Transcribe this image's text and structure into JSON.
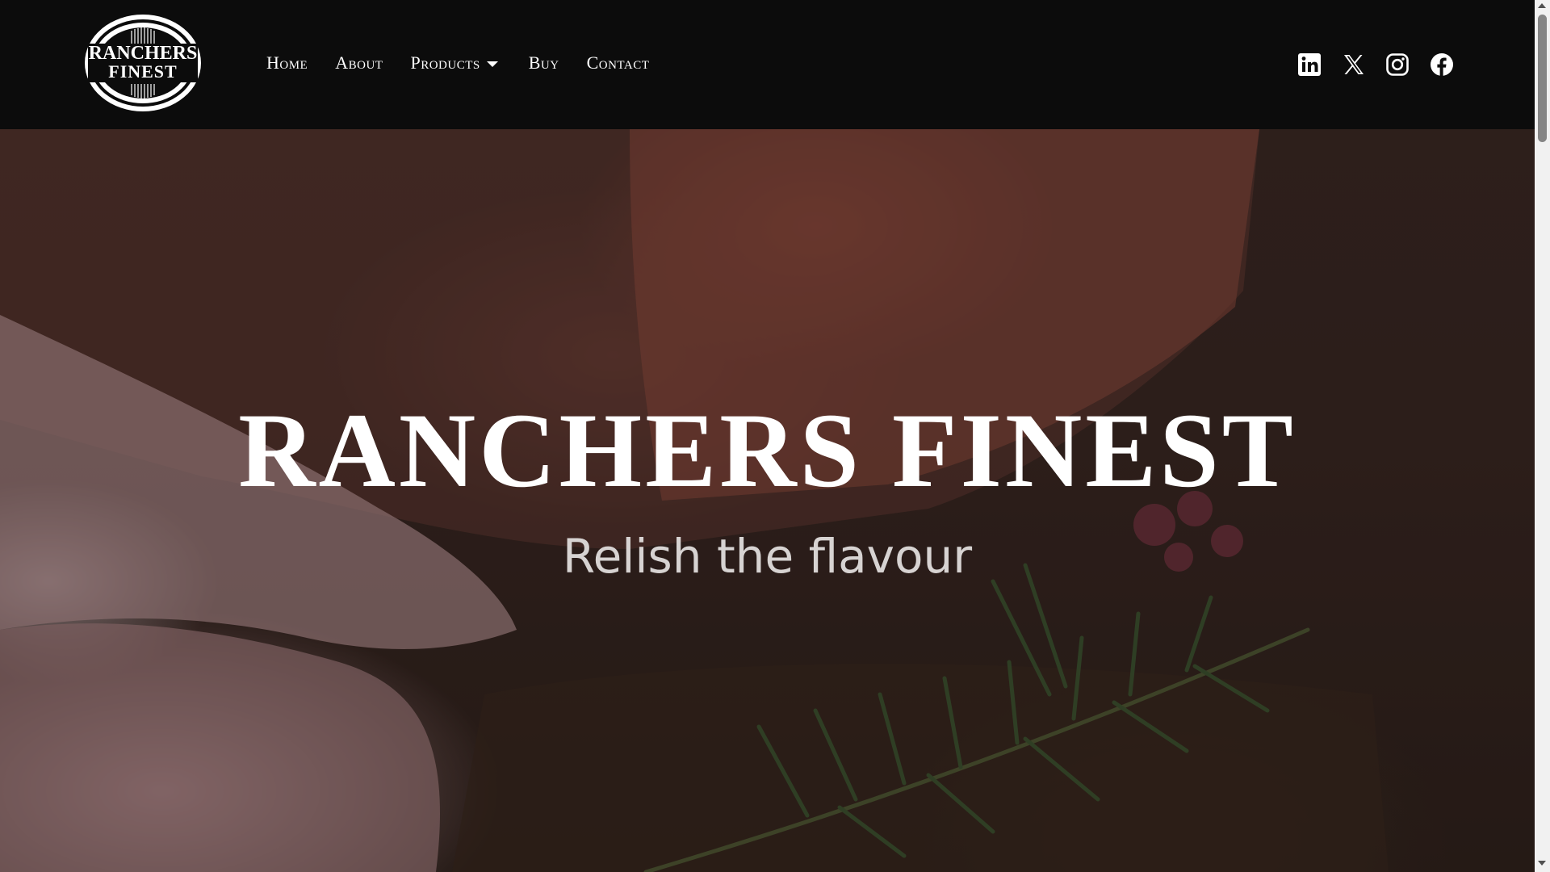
{
  "brand": {
    "logo_line1": "RANCHERS",
    "logo_line2": "FINEST"
  },
  "nav": {
    "items": [
      {
        "label": "Home"
      },
      {
        "label": "About"
      },
      {
        "label": "Products",
        "has_dropdown": true
      },
      {
        "label": "Buy"
      },
      {
        "label": "Contact"
      }
    ]
  },
  "social": {
    "icons": [
      "linkedin-icon",
      "x-icon",
      "instagram-icon",
      "facebook-icon"
    ]
  },
  "hero": {
    "title": "RANCHERS FINEST",
    "subtitle": "Relish the flavour"
  },
  "colors": {
    "header_bg": "#0c0c0c",
    "text": "#ffffff",
    "subtitle": "#d7d3d2"
  }
}
